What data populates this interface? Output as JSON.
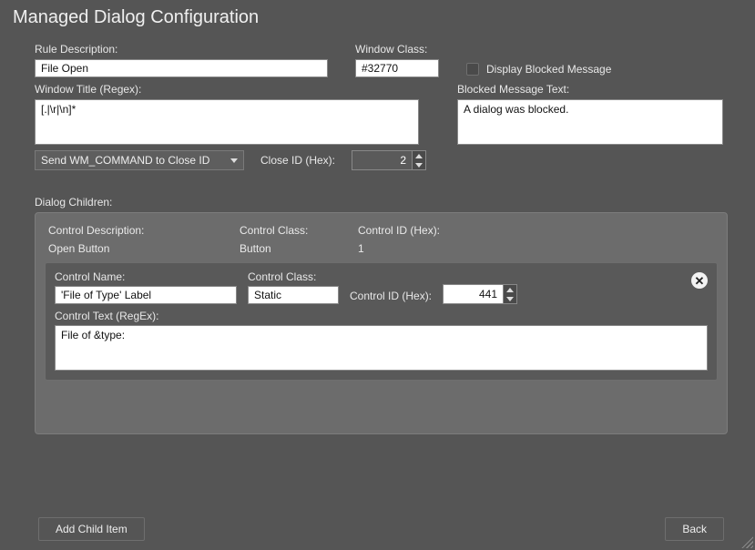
{
  "title": "Managed Dialog Configuration",
  "ruleDescription": {
    "label": "Rule Description:",
    "value": "File Open"
  },
  "windowClass": {
    "label": "Window Class:",
    "value": "#32770"
  },
  "displayBlocked": {
    "label": "Display Blocked Message",
    "checked": false
  },
  "windowTitle": {
    "label": "Window Title (Regex):",
    "value": "[.|\\r|\\n]*"
  },
  "blockedMessage": {
    "label": "Blocked Message Text:",
    "value": "A dialog was blocked."
  },
  "closeAction": {
    "selected": "Send WM_COMMAND to Close ID"
  },
  "closeId": {
    "label": "Close ID (Hex):",
    "value": "2"
  },
  "dialogChildren": {
    "label": "Dialog Children:",
    "headers": {
      "desc": "Control Description:",
      "class": "Control Class:",
      "id": "Control ID (Hex):"
    },
    "row": {
      "desc": "Open Button",
      "class": "Button",
      "id": "1"
    },
    "form": {
      "controlName": {
        "label": "Control Name:",
        "value": "'File of Type' Label"
      },
      "controlClass": {
        "label": "Control Class:",
        "value": "Static"
      },
      "controlId": {
        "label": "Control ID (Hex):",
        "value": "441"
      },
      "controlText": {
        "label": "Control Text (RegEx):",
        "value": "File of &type:"
      }
    }
  },
  "buttons": {
    "add": "Add Child Item",
    "back": "Back"
  }
}
